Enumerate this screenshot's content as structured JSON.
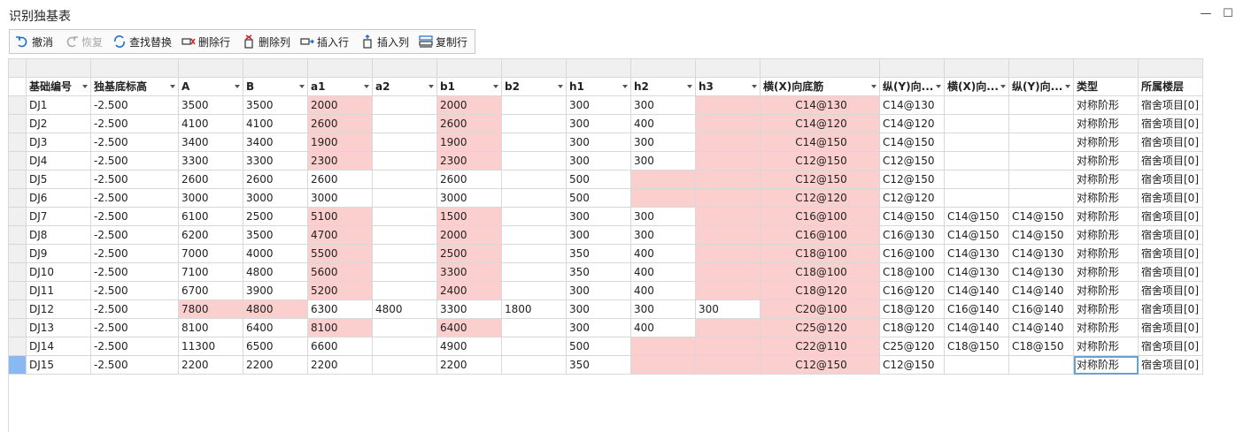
{
  "window": {
    "title": "识别独基表",
    "minimize": "—",
    "maximize": "☐"
  },
  "toolbar": {
    "undo": "撤消",
    "redo": "恢复",
    "find_replace": "查找替换",
    "delete_row": "删除行",
    "delete_col": "删除列",
    "insert_row": "插入行",
    "insert_col": "插入列",
    "copy_row": "复制行"
  },
  "columns": [
    "基础编号",
    "独基底标高",
    "A",
    "B",
    "a1",
    "a2",
    "b1",
    "b2",
    "h1",
    "h2",
    "h3",
    "横(X)向底筋",
    "纵(Y)向...",
    "横(X)向...",
    "纵(Y)向...",
    "类型",
    "所属楼层"
  ],
  "rows": [
    {
      "cells": [
        "DJ1",
        "-2.500",
        "3500",
        "3500",
        "2000",
        "",
        "2000",
        "",
        "300",
        "300",
        "",
        "C14@130",
        "C14@130",
        "",
        "",
        "对称阶形",
        "宿舍项目[0]"
      ],
      "pink": [
        4,
        6,
        10,
        11
      ]
    },
    {
      "cells": [
        "DJ2",
        "-2.500",
        "4100",
        "4100",
        "2600",
        "",
        "2600",
        "",
        "300",
        "400",
        "",
        "C14@120",
        "C14@120",
        "",
        "",
        "对称阶形",
        "宿舍项目[0]"
      ],
      "pink": [
        4,
        6,
        10,
        11
      ]
    },
    {
      "cells": [
        "DJ3",
        "-2.500",
        "3400",
        "3400",
        "1900",
        "",
        "1900",
        "",
        "300",
        "300",
        "",
        "C14@150",
        "C14@150",
        "",
        "",
        "对称阶形",
        "宿舍项目[0]"
      ],
      "pink": [
        4,
        6,
        10,
        11
      ]
    },
    {
      "cells": [
        "DJ4",
        "-2.500",
        "3300",
        "3300",
        "2300",
        "",
        "2300",
        "",
        "300",
        "300",
        "",
        "C12@150",
        "C12@150",
        "",
        "",
        "对称阶形",
        "宿舍项目[0]"
      ],
      "pink": [
        4,
        6,
        10,
        11
      ]
    },
    {
      "cells": [
        "DJ5",
        "-2.500",
        "2600",
        "2600",
        "2600",
        "",
        "2600",
        "",
        "500",
        "",
        "",
        "C12@150",
        "C12@150",
        "",
        "",
        "对称阶形",
        "宿舍项目[0]"
      ],
      "pink": [
        9,
        10,
        11
      ]
    },
    {
      "cells": [
        "DJ6",
        "-2.500",
        "3000",
        "3000",
        "3000",
        "",
        "3000",
        "",
        "500",
        "",
        "",
        "C12@120",
        "C12@120",
        "",
        "",
        "对称阶形",
        "宿舍项目[0]"
      ],
      "pink": [
        9,
        10,
        11
      ]
    },
    {
      "cells": [
        "DJ7",
        "-2.500",
        "6100",
        "2500",
        "5100",
        "",
        "1500",
        "",
        "300",
        "300",
        "",
        "C16@100",
        "C14@150",
        "C14@150",
        "C14@150",
        "对称阶形",
        "宿舍项目[0]"
      ],
      "pink": [
        4,
        6,
        10,
        11
      ]
    },
    {
      "cells": [
        "DJ8",
        "-2.500",
        "6200",
        "3500",
        "4700",
        "",
        "2000",
        "",
        "300",
        "300",
        "",
        "C16@100",
        "C16@130",
        "C14@150",
        "C14@150",
        "对称阶形",
        "宿舍项目[0]"
      ],
      "pink": [
        4,
        6,
        10,
        11
      ]
    },
    {
      "cells": [
        "DJ9",
        "-2.500",
        "7000",
        "4000",
        "5500",
        "",
        "2500",
        "",
        "350",
        "400",
        "",
        "C18@100",
        "C16@100",
        "C14@130",
        "C14@130",
        "对称阶形",
        "宿舍项目[0]"
      ],
      "pink": [
        4,
        6,
        10,
        11
      ]
    },
    {
      "cells": [
        "DJ10",
        "-2.500",
        "7100",
        "4800",
        "5600",
        "",
        "3300",
        "",
        "350",
        "400",
        "",
        "C18@100",
        "C18@100",
        "C14@130",
        "C14@130",
        "对称阶形",
        "宿舍项目[0]"
      ],
      "pink": [
        4,
        6,
        10,
        11
      ]
    },
    {
      "cells": [
        "DJ11",
        "-2.500",
        "6700",
        "3900",
        "5200",
        "",
        "2400",
        "",
        "300",
        "400",
        "",
        "C18@120",
        "C16@120",
        "C14@140",
        "C14@140",
        "对称阶形",
        "宿舍项目[0]"
      ],
      "pink": [
        4,
        6,
        10,
        11
      ]
    },
    {
      "cells": [
        "DJ12",
        "-2.500",
        "7800",
        "4800",
        "6300",
        "4800",
        "3300",
        "1800",
        "300",
        "300",
        "300",
        "C20@100",
        "C18@120",
        "C16@140",
        "C16@140",
        "对称阶形",
        "宿舍项目[0]"
      ],
      "pink": [
        2,
        3,
        11
      ]
    },
    {
      "cells": [
        "DJ13",
        "-2.500",
        "8100",
        "6400",
        "8100",
        "",
        "6400",
        "",
        "300",
        "400",
        "",
        "C25@120",
        "C18@120",
        "C14@140",
        "C14@140",
        "对称阶形",
        "宿舍项目[0]"
      ],
      "pink": [
        4,
        6,
        10,
        11
      ]
    },
    {
      "cells": [
        "DJ14",
        "-2.500",
        "11300",
        "6500",
        "6600",
        "",
        "4900",
        "",
        "500",
        "",
        "",
        "C22@110",
        "C25@120",
        "C18@150",
        "C18@150",
        "对称阶形",
        "宿舍项目[0]"
      ],
      "pink": [
        9,
        10,
        11
      ]
    },
    {
      "cells": [
        "DJ15",
        "-2.500",
        "2200",
        "2200",
        "2200",
        "",
        "2200",
        "",
        "350",
        "",
        "",
        "C12@150",
        "C12@150",
        "",
        "",
        "对称阶形",
        "宿舍项目[0]"
      ],
      "pink": [
        9,
        10,
        11
      ]
    }
  ],
  "selection": {
    "row": 14,
    "col": 15
  },
  "colors": {
    "highlight": "#fccfcf",
    "selection": "#8ab8f0"
  }
}
